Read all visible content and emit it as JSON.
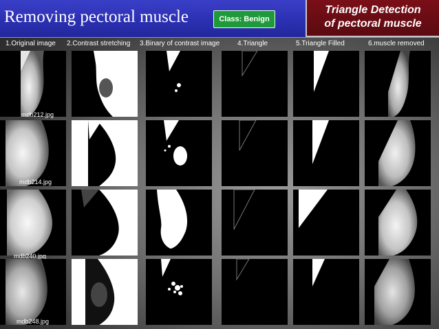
{
  "header": {
    "title": "Removing pectoral muscle",
    "class_badge": "Class: Benign",
    "triangle_title_line1": "Triangle Detection",
    "triangle_title_line2": "of pectoral muscle"
  },
  "columns": [
    "1.Original image",
    "2.Contrast stretching",
    "3.Binary of contrast image",
    "4.Triangle",
    "5.Triangle Filled",
    "6.muscle removed"
  ],
  "rows": [
    {
      "filename": "mdb212.jpg"
    },
    {
      "filename": "mdb214.jpg"
    },
    {
      "filename": "mdb240.jpg"
    },
    {
      "filename": "mdb248.jpg"
    }
  ]
}
